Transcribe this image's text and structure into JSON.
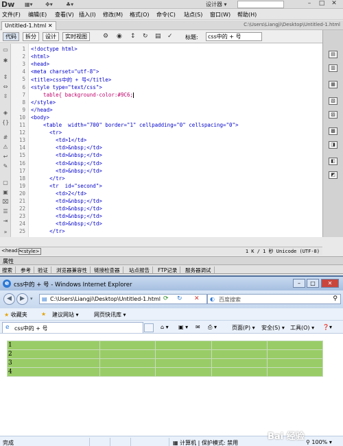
{
  "dreamweaver": {
    "logo": "Dw",
    "mode": "设计器 ▾",
    "menu": [
      "文件(F)",
      "编辑(E)",
      "查看(V)",
      "插入(I)",
      "修改(M)",
      "格式(O)",
      "命令(C)",
      "站点(S)",
      "窗口(W)",
      "帮助(H)"
    ],
    "doc_tab": "Untitled-1.html",
    "doc_path": "C:\\Users\\Liangji\\Desktop\\Untitled-1.html",
    "view_buttons": [
      "代码",
      "拆分",
      "设计",
      "实时视图"
    ],
    "title_label": "标题:",
    "title_value": "css中的 + 号",
    "line_numbers": [
      "1",
      "2",
      "3",
      "4",
      "5",
      "6",
      "7",
      "8",
      "9",
      "10",
      "11",
      "12",
      "13",
      "14",
      "15",
      "16",
      "17",
      "18",
      "19",
      "20",
      "21",
      "22",
      "23",
      "24",
      "25"
    ],
    "code_lines": [
      "<!doctype html>",
      "<html>",
      "<head>",
      "<meta charset=\"utf-8\">",
      "<title>css中的 + 号</title>",
      "<style type=\"text/css\">",
      "    table{ background-color:#9C6;",
      "</style>",
      "</head>",
      "<body>",
      "    <table  width=\"700\" border=\"1\" cellpadding=\"0\" cellspacing=\"0\">",
      "      <tr>",
      "        <td>1</td>",
      "        <td>&nbsp;</td>",
      "        <td>&nbsp;</td>",
      "        <td>&nbsp;</td>",
      "        <td>&nbsp;</td>",
      "      </tr>",
      "      <tr  id=\"second\">",
      "        <td>2</td>",
      "        <td>&nbsp;</td>",
      "        <td>&nbsp;</td>",
      "        <td>&nbsp;</td>",
      "        <td>&nbsp;</td>",
      "      </tr>"
    ],
    "tag_head": "<head>",
    "tag_style": "<style>",
    "status_info": "1 K / 1 秒  Unicode (UTF-8)",
    "props_label": "属性",
    "panel_tabs": [
      "搜索",
      "参考",
      "验证",
      "浏览器兼容性",
      "链接检查器",
      "站点报告",
      "FTP记录",
      "服务器调试"
    ]
  },
  "ie": {
    "window_title": "css中的 + 号 - Windows Internet Explorer",
    "url": "C:\\Users\\Liangji\\Desktop\\Untitled-1.html",
    "search_placeholder": "百度搜索",
    "favorites": "收藏夹",
    "fav_links": [
      "建议网站 ▾",
      "网页快讯库 ▾"
    ],
    "page_tab": "css中的 + 号",
    "cmd_items": [
      "页面(P) ▾",
      "安全(S) ▾",
      "工具(O) ▾"
    ],
    "table_rows": [
      [
        "1",
        "",
        "",
        "",
        ""
      ],
      [
        "2",
        "",
        "",
        "",
        ""
      ],
      [
        "3",
        "",
        "",
        "",
        ""
      ],
      [
        "4",
        "",
        "",
        "",
        ""
      ]
    ],
    "status_done": "完成",
    "status_zone": "计算机 | 保护模式: 禁用",
    "zoom": "100%",
    "watermark": "Bai 经验"
  },
  "colors": {
    "table_bg": "#99CC66",
    "ie_frame": "#4f6f9b"
  }
}
